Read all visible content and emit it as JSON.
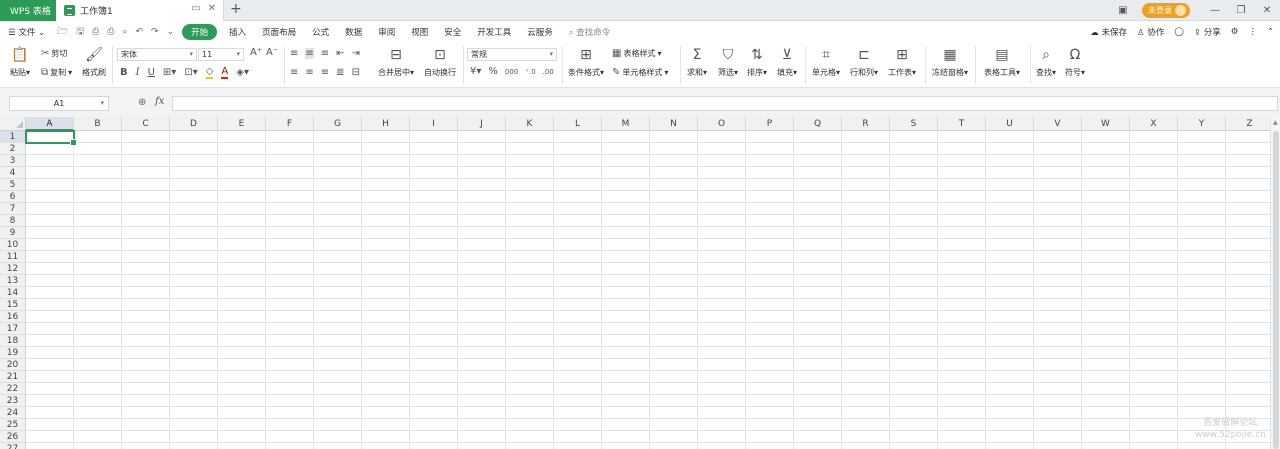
{
  "titlebar": {
    "app_tab": "WPS 表格",
    "doc_tab": "工作簿1",
    "login_label": "未登录"
  },
  "menu": {
    "file": "文件",
    "tabs": [
      "开始",
      "插入",
      "页面布局",
      "公式",
      "数据",
      "审阅",
      "视图",
      "安全",
      "开发工具",
      "云服务"
    ],
    "search": "查找命令",
    "right": {
      "unsaved": "未保存",
      "collab": "协作",
      "share": "分享"
    }
  },
  "ribbon": {
    "paste": "粘贴",
    "cut": "剪切",
    "copy": "复制",
    "format_painter": "格式刷",
    "font_name": "宋体",
    "font_size": "11",
    "merge_center": "合并居中",
    "wrap_text": "自动换行",
    "number_format": "常规",
    "conditional_format": "条件格式",
    "table_style": "表格样式",
    "cell_style": "单元格样式",
    "sum": "求和",
    "filter": "筛选",
    "sort": "排序",
    "fill": "填充",
    "cells": "单元格",
    "rows_cols": "行和列",
    "worksheet": "工作表",
    "freeze": "冻结窗格",
    "table_tools": "表格工具",
    "find": "查找",
    "symbol": "符号"
  },
  "formula_bar": {
    "name_box": "A1",
    "fx_label": "fx",
    "formula": ""
  },
  "grid": {
    "columns": [
      "A",
      "B",
      "C",
      "D",
      "E",
      "F",
      "G",
      "H",
      "I",
      "J",
      "K",
      "L",
      "M",
      "N",
      "O",
      "P",
      "Q",
      "R",
      "S",
      "T",
      "U",
      "V",
      "W",
      "X",
      "Y",
      "Z"
    ],
    "rows": [
      "1",
      "2",
      "3",
      "4",
      "5",
      "6",
      "7",
      "8",
      "9",
      "10",
      "11",
      "12",
      "13",
      "14",
      "15",
      "16",
      "17",
      "18",
      "19",
      "20",
      "21",
      "22",
      "23",
      "24",
      "25",
      "26",
      "27"
    ],
    "selected_cell": "A1"
  },
  "watermark": {
    "line1": "吾爱破解论坛",
    "line2": "www.52pojie.cn"
  }
}
